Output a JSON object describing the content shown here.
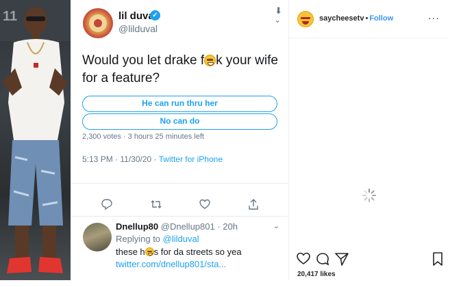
{
  "tweet": {
    "display_name": "lil duval",
    "handle": "@lilduval",
    "text_before": "Would you let drake f",
    "text_after": "k your wife for a feature?",
    "poll_options": [
      "He can run thru her",
      "No can do"
    ],
    "poll_meta": "2,300 votes · 3 hours 25 minutes left",
    "timestamp": "5:13 PM · 11/30/20 · ",
    "source": "Twitter for iPhone",
    "icons": [
      "download-icon",
      "chevron-down-icon",
      "reply-icon",
      "retweet-icon",
      "like-icon",
      "share-icon",
      "verified-badge-icon"
    ],
    "accent_color": "#1da1f2"
  },
  "reply": {
    "name": "Dnellup80",
    "handle_time": "@Dnellup801 · 20h",
    "replying_label": "Replying to ",
    "replying_to": "@lilduval",
    "text_before": "these h",
    "text_after": "s for da streets so yea",
    "link": "twitter.com/dnellup801/sta..."
  },
  "instagram": {
    "username": "saycheesetv",
    "separator": "•",
    "follow_label": "Follow",
    "more_label": "···",
    "likes": "20,417 likes",
    "icons": [
      "heart-icon",
      "comment-icon",
      "send-icon",
      "bookmark-icon",
      "loading-spinner-icon"
    ],
    "accent_color": "#3897f0"
  }
}
